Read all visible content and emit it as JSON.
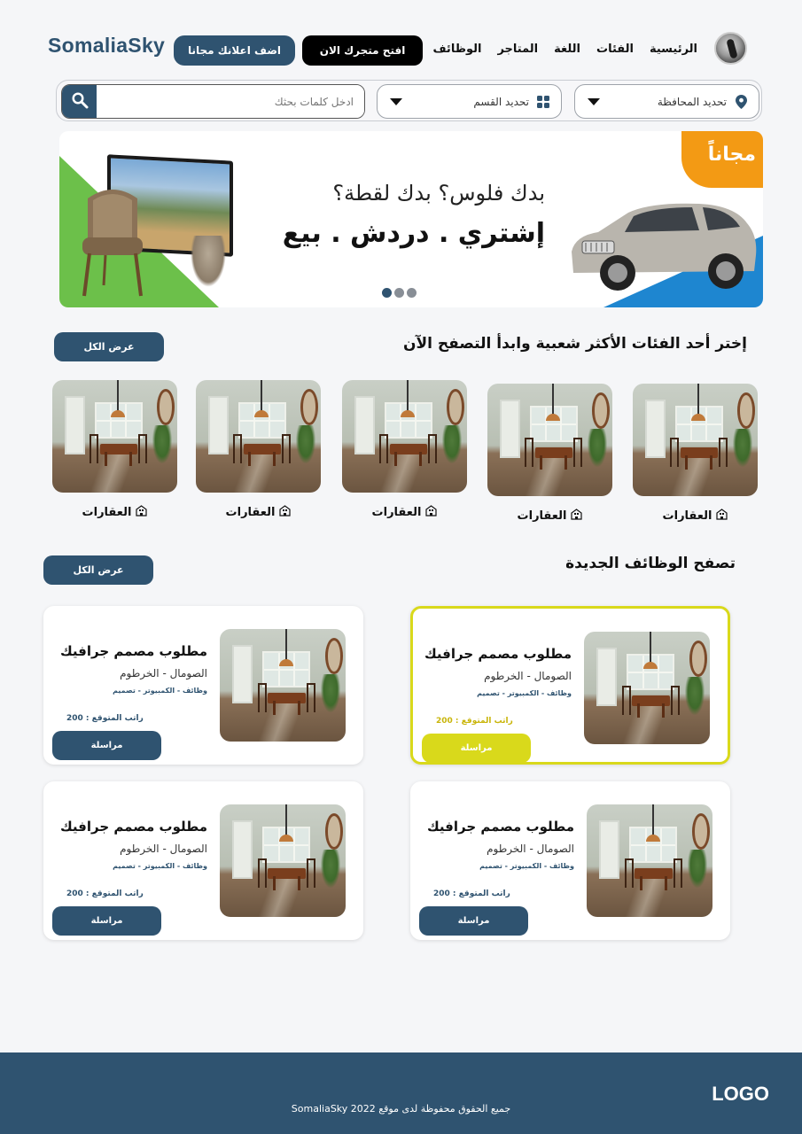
{
  "header": {
    "logo": "SomaliaSky",
    "add_ad_label": "اضف اعلانك مجانا",
    "open_store_label": "افتح متجرك الان",
    "nav": [
      "الرئيسية",
      "الفئات",
      "اللغة",
      "المتاجر",
      "الوظائف"
    ]
  },
  "search": {
    "governorate_label": "تحديد المحافظة",
    "category_label": "تحديد القسم",
    "keyword_placeholder": "ادخل كلمات بحثك"
  },
  "banner": {
    "badge": "مجاناً",
    "line1": "بدك فلوس؟ بدك لقطة؟",
    "line2": "إشتري . دردش . بيع",
    "slides": 3,
    "active_slide": 1
  },
  "categories_section": {
    "title": "إختر أحد الفئات الأكثر شعبية وابدأ التصفح الآن",
    "view_all": "عرض الكل",
    "items": [
      {
        "label": "العقارات"
      },
      {
        "label": "العقارات"
      },
      {
        "label": "العقارات"
      },
      {
        "label": "العقارات"
      },
      {
        "label": "العقارات"
      }
    ]
  },
  "jobs_section": {
    "title": "تصفح الوظائف الجديدة",
    "view_all": "عرض الكل",
    "jobs": [
      {
        "title": "مطلوب مصمم جرافيك",
        "location": "الصومال - الخرطوم",
        "tags": "وظائف - الكمبيوتر - تصميم",
        "salary": "راتب المتوقع : 200",
        "action": "مراسلة",
        "highlighted": true
      },
      {
        "title": "مطلوب مصمم جرافيك",
        "location": "الصومال - الخرطوم",
        "tags": "وظائف - الكمبيوتر - تصميم",
        "salary": "راتب المتوقع : 200",
        "action": "مراسلة",
        "highlighted": false
      },
      {
        "title": "مطلوب مصمم جرافيك",
        "location": "الصومال - الخرطوم",
        "tags": "وظائف - الكمبيوتر - تصميم",
        "salary": "راتب المتوقع : 200",
        "action": "مراسلة",
        "highlighted": false
      },
      {
        "title": "مطلوب مصمم جرافيك",
        "location": "الصومال - الخرطوم",
        "tags": "وظائف - الكمبيوتر - تصميم",
        "salary": "راتب المتوقع : 200",
        "action": "مراسلة",
        "highlighted": false
      }
    ]
  },
  "footer": {
    "logo": "LOGO",
    "copyright": "جميع الحقوق محفوظة لدى موقع SomaliaSky 2022"
  },
  "colors": {
    "primary": "#2f5370",
    "highlight": "#d9d91b",
    "banner_green": "#6cc04a",
    "banner_blue": "#1e86d0",
    "banner_orange": "#f39a14"
  },
  "icons": [
    "search-icon",
    "location-pin-icon",
    "grid-icon",
    "chevron-down-icon",
    "building-icon",
    "avatar"
  ]
}
